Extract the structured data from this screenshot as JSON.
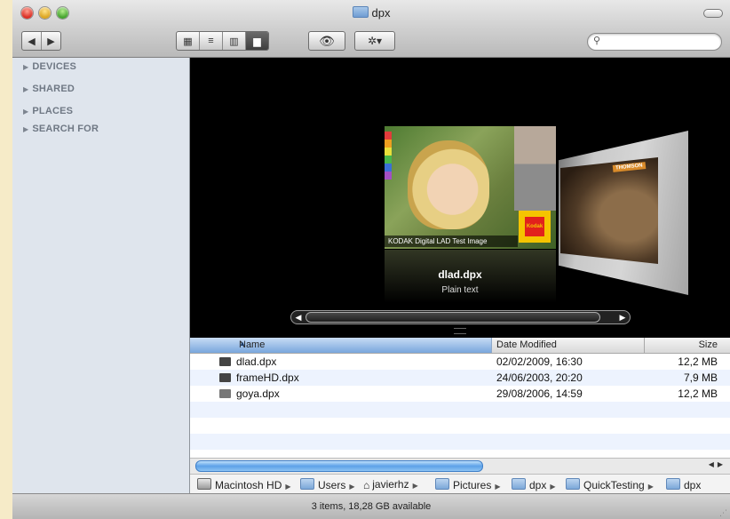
{
  "window": {
    "title": "dpx"
  },
  "toolbar": {
    "back": "◀",
    "forward": "▶",
    "views": [
      "▦",
      "≡",
      "▥",
      "▆"
    ],
    "quicklook": "👁",
    "action": "✲▾",
    "search_placeholder": ""
  },
  "sidebar": {
    "items": [
      {
        "label": "DEVICES"
      },
      {
        "label": "SHARED"
      },
      {
        "label": "PLACES"
      },
      {
        "label": "SEARCH FOR"
      }
    ]
  },
  "coverflow": {
    "selected_name": "dlad.dpx",
    "selected_kind": "Plain text",
    "image_caption": "KODAK Digital LAD Test Image",
    "side_label": "THOMSON",
    "kodak_text": "Kodak",
    "scroll_position": 0.0
  },
  "list": {
    "columns": {
      "name": "Name",
      "date": "Date Modified",
      "size": "Size"
    },
    "rows": [
      {
        "name": "dlad.dpx",
        "date": "02/02/2009, 16:30",
        "size": "12,2 MB"
      },
      {
        "name": "frameHD.dpx",
        "date": "24/06/2003, 20:20",
        "size": "7,9 MB"
      },
      {
        "name": "goya.dpx",
        "date": "29/08/2006, 14:59",
        "size": "12,2 MB"
      }
    ]
  },
  "pathbar": [
    "Macintosh HD",
    "Users",
    "javierhz",
    "Pictures",
    "dpx",
    "QuickTesting",
    "dpx"
  ],
  "status": {
    "text": "3 items, 18,28 GB available"
  },
  "colors": {
    "accent": "#79a6dc",
    "sidebar_bg": "#dfe5ed",
    "desktop": "#f6ebc8"
  }
}
